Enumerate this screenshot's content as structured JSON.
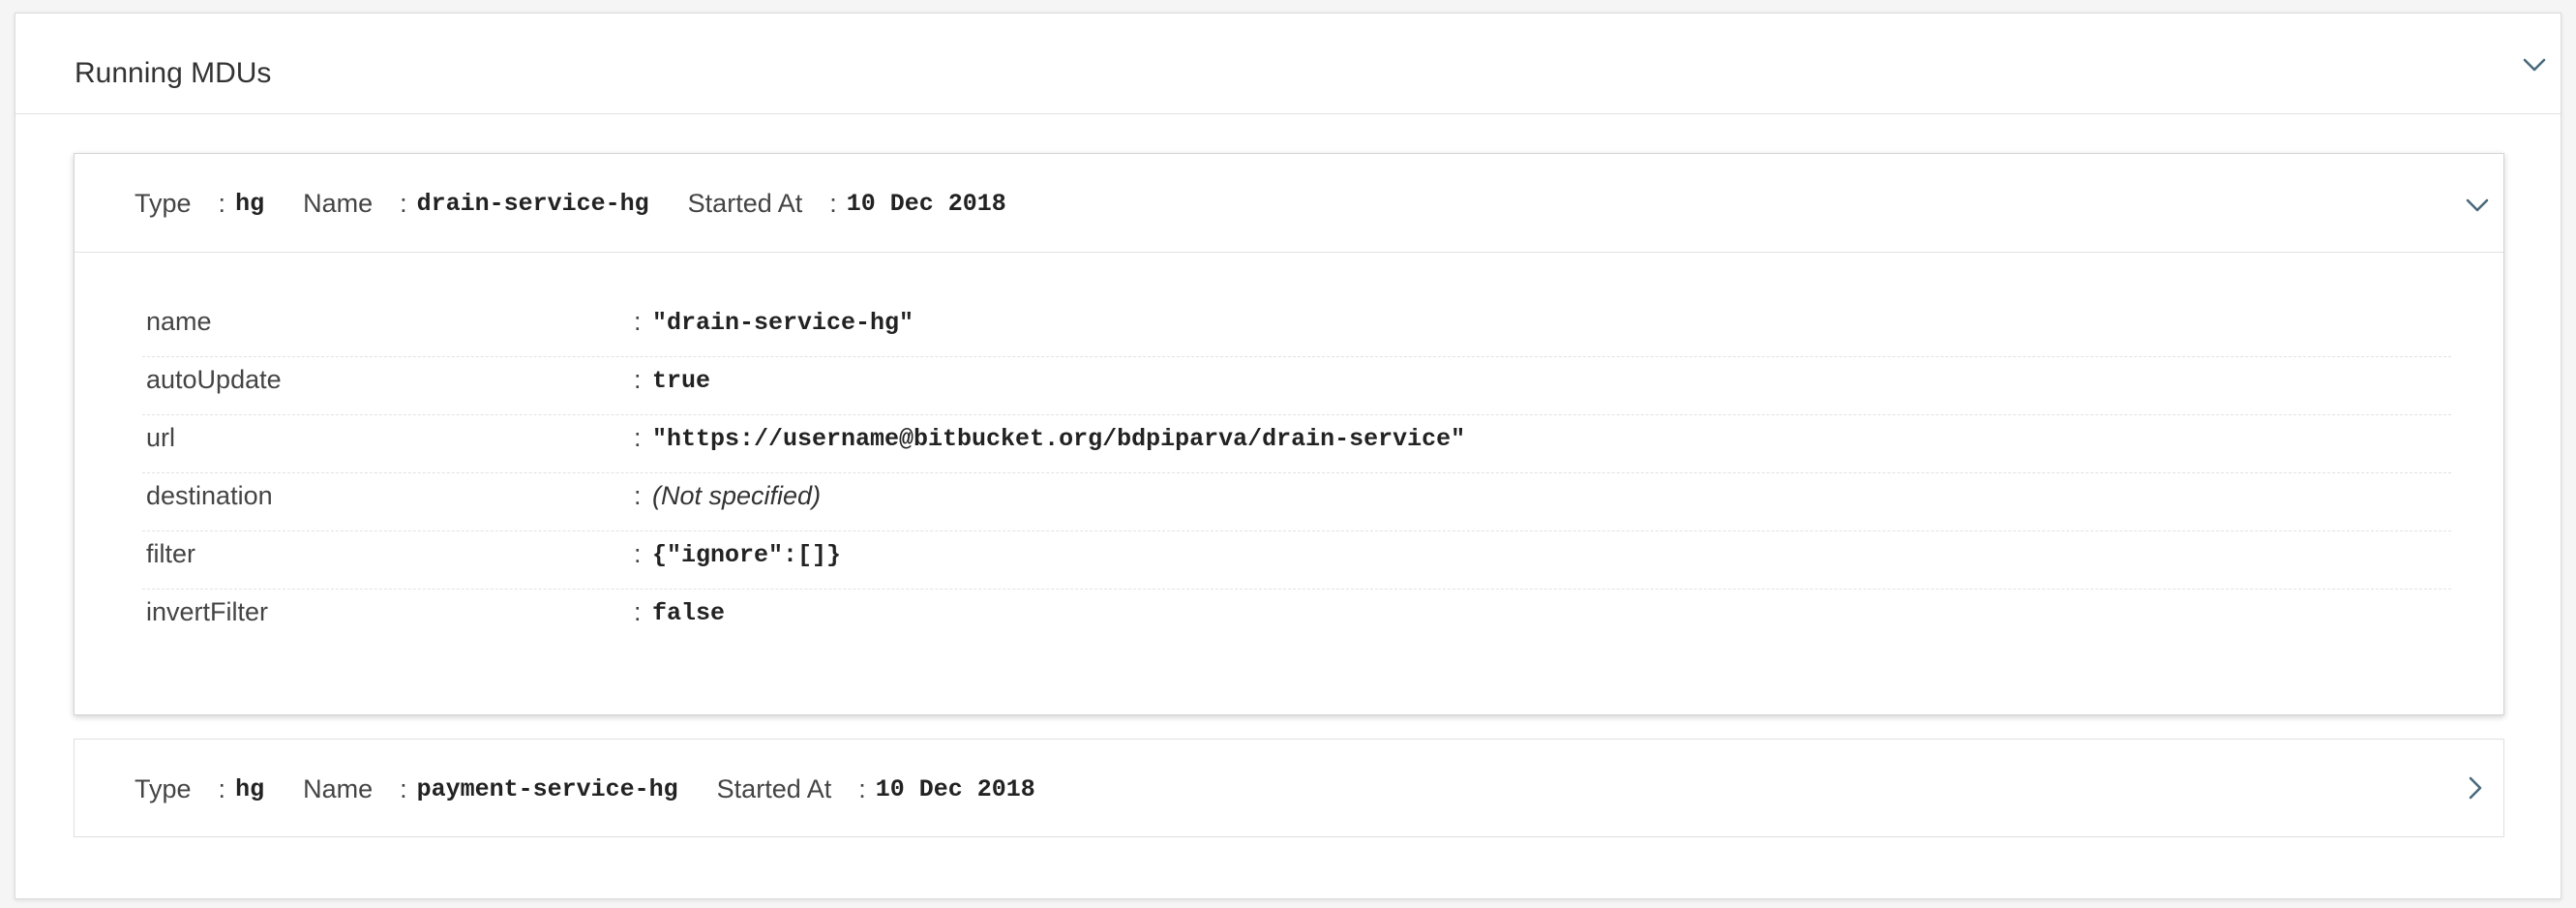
{
  "panel": {
    "title": "Running MDUs",
    "toggle_icon": "chevron-down-icon"
  },
  "mdus": [
    {
      "type_label": "Type",
      "type_value": "hg",
      "name_label": "Name",
      "name_value": "drain-service-hg",
      "started_label": "Started At",
      "started_value": "10 Dec 2018",
      "toggle_icon": "chevron-down-icon",
      "expanded": true,
      "properties": [
        {
          "key": "name",
          "value": "\"drain-service-hg\""
        },
        {
          "key": "autoUpdate",
          "value": "true"
        },
        {
          "key": "url",
          "value": "\"https://username@bitbucket.org/bdpiparva/drain-service\""
        },
        {
          "key": "destination",
          "value": "(Not specified)"
        },
        {
          "key": "filter",
          "value": "{\"ignore\":[]}"
        },
        {
          "key": "invertFilter",
          "value": "false"
        }
      ]
    },
    {
      "type_label": "Type",
      "type_value": "hg",
      "name_label": "Name",
      "name_value": "payment-service-hg",
      "started_label": "Started At",
      "started_value": "10 Dec 2018",
      "toggle_icon": "chevron-right-icon",
      "expanded": false
    }
  ],
  "separator": ":",
  "colors": {
    "background": "#f5f5f5",
    "card": "#ffffff",
    "border": "#e0e0e0",
    "chevron": "#4a6a7c"
  }
}
